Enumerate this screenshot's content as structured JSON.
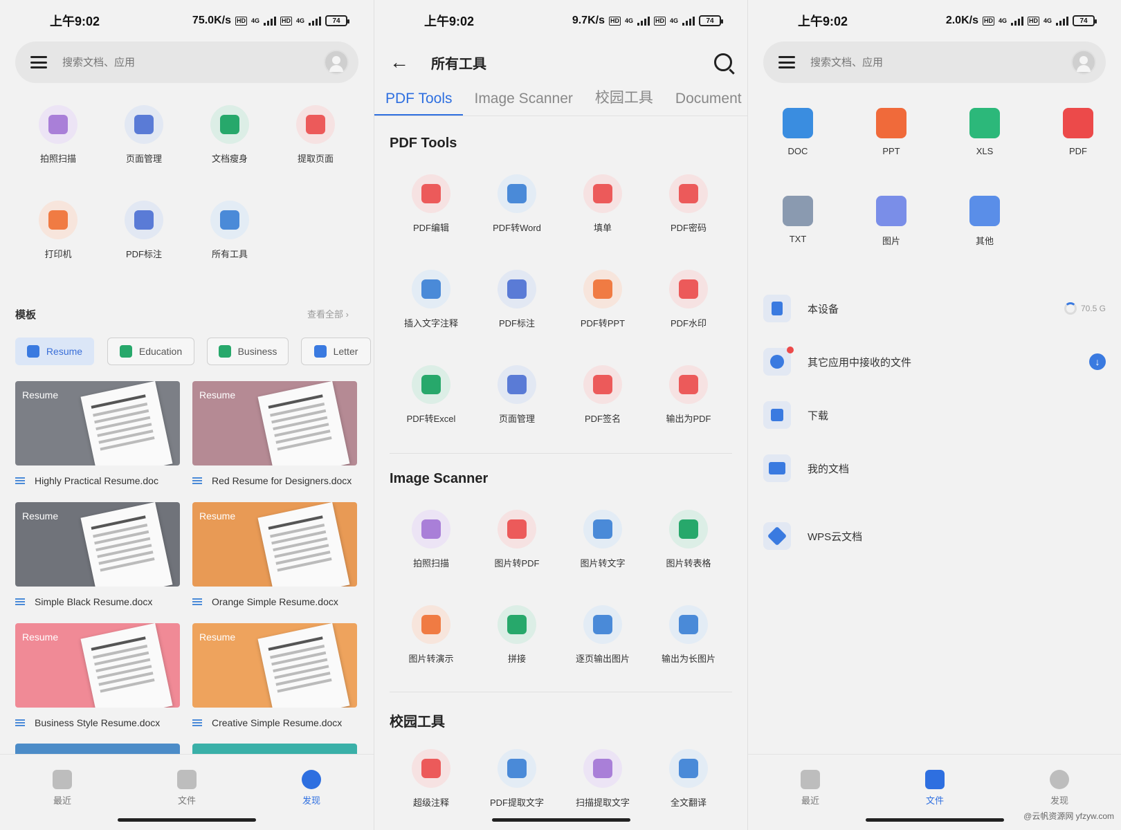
{
  "left": {
    "status": {
      "time": "上午9:02",
      "speed": "75.0K/s",
      "net1": "4G",
      "net2": "4G",
      "hd": "HD",
      "battery": "74"
    },
    "search": {
      "placeholder": "搜索文档、应用"
    },
    "tools": [
      {
        "label": "拍照扫描",
        "icon": "scan-icon",
        "color": "purple"
      },
      {
        "label": "页面管理",
        "icon": "page-manage-icon",
        "color": "blue"
      },
      {
        "label": "文档瘦身",
        "icon": "doc-slim-icon",
        "color": "green"
      },
      {
        "label": "提取页面",
        "icon": "extract-page-icon",
        "color": "red"
      },
      {
        "label": "打印机",
        "icon": "printer-icon",
        "color": "orange"
      },
      {
        "label": "PDF标注",
        "icon": "pdf-annotate-icon",
        "color": "blue"
      },
      {
        "label": "所有工具",
        "icon": "more-dots-icon",
        "color": "lblue"
      }
    ],
    "templates": {
      "title": "模板",
      "more": "查看全部"
    },
    "chips": [
      {
        "label": "Resume",
        "active": true
      },
      {
        "label": "Education",
        "active": false
      },
      {
        "label": "Business",
        "active": false
      },
      {
        "label": "Letter",
        "active": false
      }
    ],
    "cards": [
      {
        "thumb": "Resume",
        "name": "Highly Practical Resume.doc",
        "bg": "#7c7f86"
      },
      {
        "thumb": "Resume",
        "name": "Red Resume for Designers.docx",
        "bg": "#b58a94"
      },
      {
        "thumb": "Resume",
        "name": "Simple Black Resume.docx",
        "bg": "#70737a"
      },
      {
        "thumb": "Resume",
        "name": "Orange Simple Resume.docx",
        "bg": "#e89a55"
      },
      {
        "thumb": "Resume",
        "name": "Business Style Resume.docx",
        "bg": "#f08a96"
      },
      {
        "thumb": "Resume",
        "name": "Creative Simple Resume.docx",
        "bg": "#eea35d"
      }
    ],
    "nav": [
      {
        "label": "最近",
        "active": false
      },
      {
        "label": "文件",
        "active": false
      },
      {
        "label": "发现",
        "active": true
      }
    ]
  },
  "middle": {
    "status": {
      "time": "上午9:02",
      "speed": "9.7K/s",
      "net1": "4G",
      "net2": "4G",
      "hd": "HD",
      "battery": "74"
    },
    "title": "所有工具",
    "tabs": [
      {
        "label": "PDF Tools",
        "active": true
      },
      {
        "label": "Image Scanner",
        "active": false
      },
      {
        "label": "校园工具",
        "active": false
      },
      {
        "label": "Document",
        "active": false
      }
    ],
    "sections": [
      {
        "title": "PDF Tools",
        "items": [
          {
            "label": "PDF编辑",
            "color": "red"
          },
          {
            "label": "PDF转Word",
            "color": "lblue"
          },
          {
            "label": "填单",
            "color": "red"
          },
          {
            "label": "PDF密码",
            "color": "red"
          },
          {
            "label": "插入文字注释",
            "color": "lblue"
          },
          {
            "label": "PDF标注",
            "color": "blue"
          },
          {
            "label": "PDF转PPT",
            "color": "orange"
          },
          {
            "label": "PDF水印",
            "color": "red"
          },
          {
            "label": "PDF转Excel",
            "color": "green"
          },
          {
            "label": "页面管理",
            "color": "blue"
          },
          {
            "label": "PDF签名",
            "color": "red"
          },
          {
            "label": "输出为PDF",
            "color": "red"
          }
        ]
      },
      {
        "title": "Image Scanner",
        "items": [
          {
            "label": "拍照扫描",
            "color": "purple"
          },
          {
            "label": "图片转PDF",
            "color": "red"
          },
          {
            "label": "图片转文字",
            "color": "lblue"
          },
          {
            "label": "图片转表格",
            "color": "green"
          },
          {
            "label": "图片转演示",
            "color": "orange"
          },
          {
            "label": "拼接",
            "color": "green"
          },
          {
            "label": "逐页输出图片",
            "color": "lblue"
          },
          {
            "label": "输出为长图片",
            "color": "lblue"
          }
        ]
      },
      {
        "title": "校园工具",
        "items": [
          {
            "label": "超级注释",
            "color": "red"
          },
          {
            "label": "PDF提取文字",
            "color": "lblue"
          },
          {
            "label": "扫描提取文字",
            "color": "purple"
          },
          {
            "label": "全文翻译",
            "color": "lblue"
          }
        ]
      }
    ]
  },
  "right": {
    "status": {
      "time": "上午9:02",
      "speed": "2.0K/s",
      "net1": "4G",
      "net2": "4G",
      "hd": "HD",
      "battery": "74"
    },
    "search": {
      "placeholder": "搜索文档、应用"
    },
    "filetypes": [
      {
        "label": "DOC",
        "color": "#3a8de0"
      },
      {
        "label": "PPT",
        "color": "#f06a3a"
      },
      {
        "label": "XLS",
        "color": "#2cb87a"
      },
      {
        "label": "PDF",
        "color": "#ec4a4a"
      },
      {
        "label": "TXT",
        "color": "#8a9ab0"
      },
      {
        "label": "图片",
        "color": "#7a8ee8"
      },
      {
        "label": "其他",
        "color": "#5a8ee8"
      }
    ],
    "locations": [
      {
        "label": "本设备",
        "extra": "70.5 G"
      },
      {
        "label": "其它应用中接收的文件",
        "extra": ""
      },
      {
        "label": "下载",
        "extra": ""
      },
      {
        "label": "我的文档",
        "extra": ""
      },
      {
        "label": "WPS云文档",
        "extra": ""
      }
    ],
    "nav": [
      {
        "label": "最近",
        "active": false
      },
      {
        "label": "文件",
        "active": true
      },
      {
        "label": "发现",
        "active": false
      }
    ],
    "watermark": "@云帆资源网 yfzyw.com"
  }
}
